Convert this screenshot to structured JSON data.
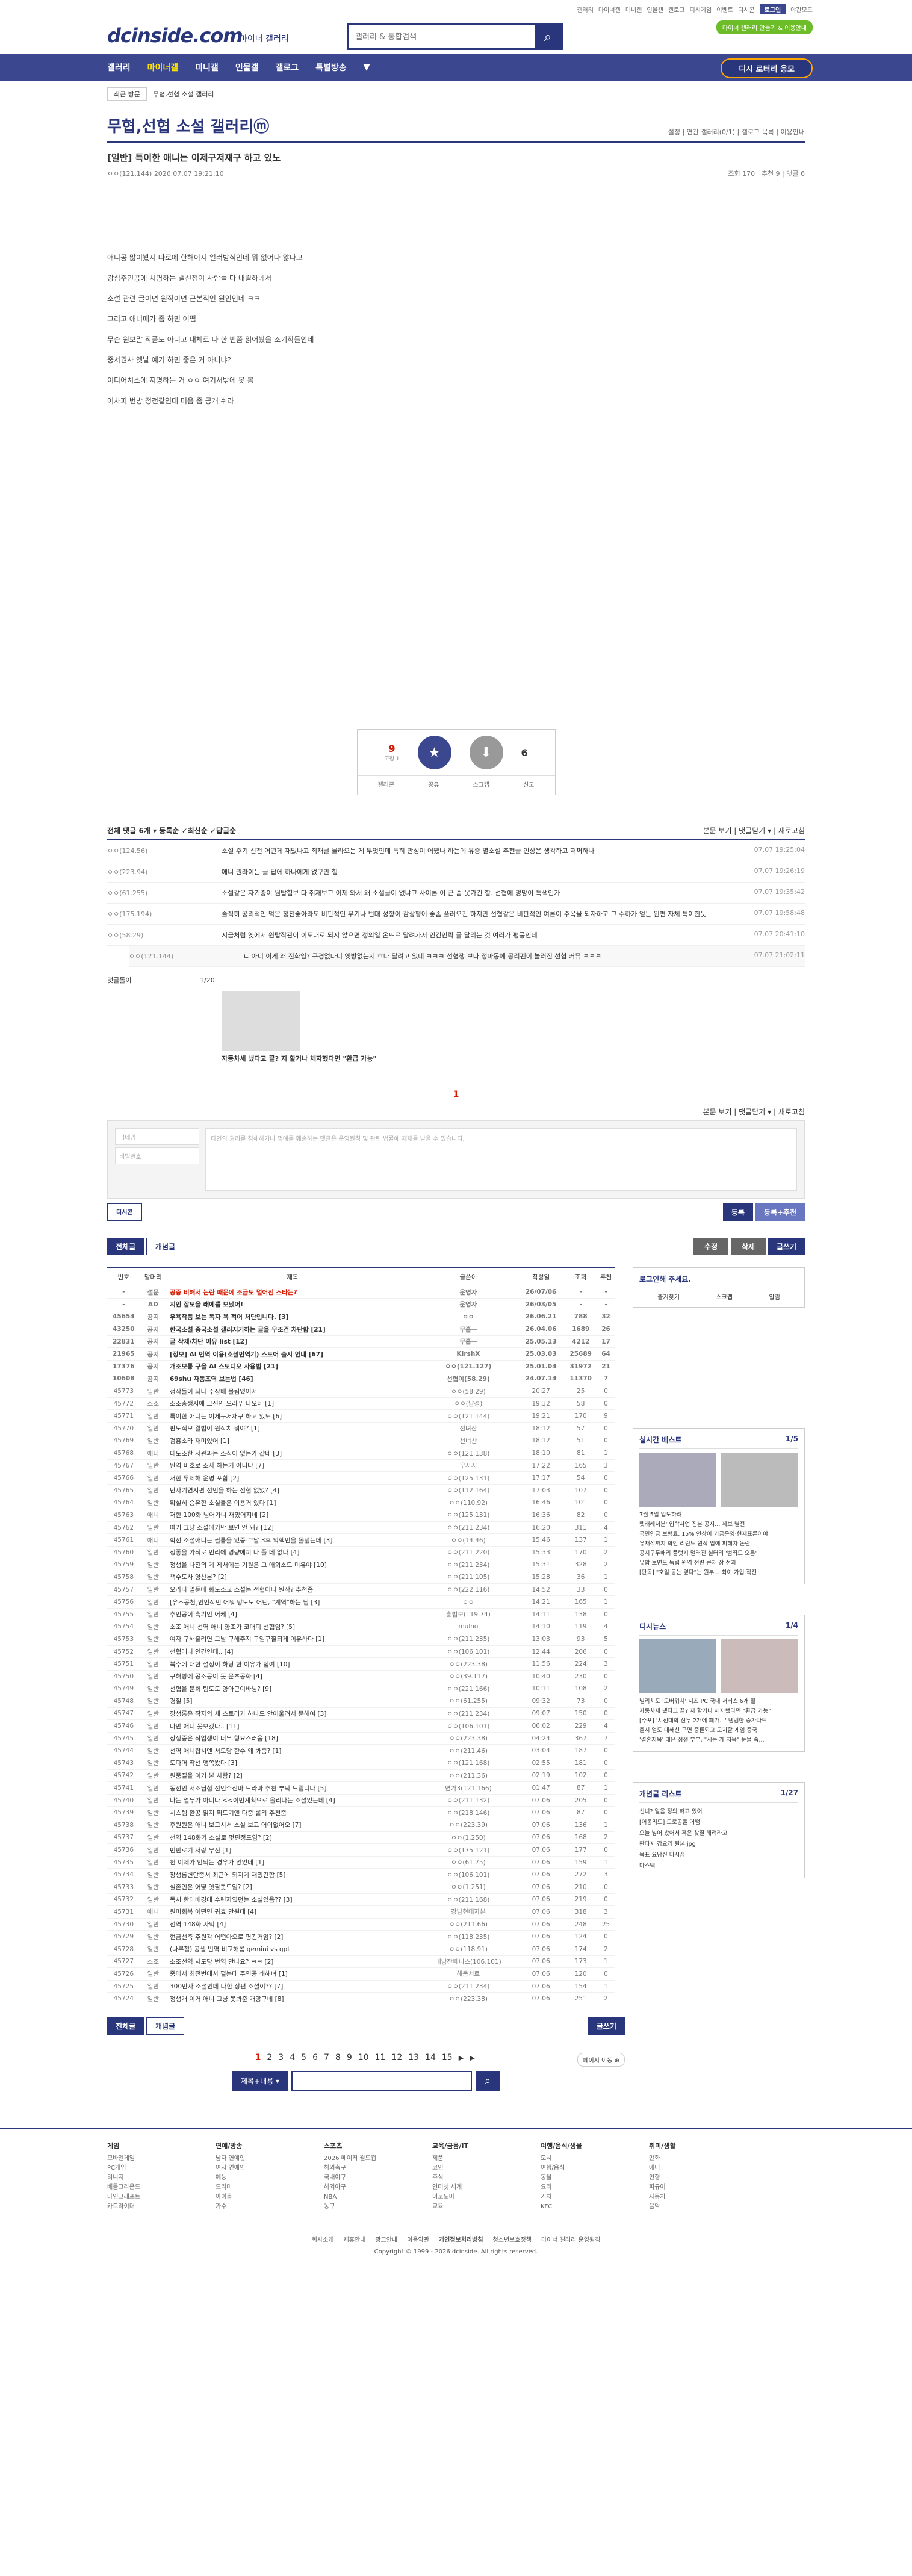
{
  "topbar": {
    "links": [
      "갤러리",
      "마이너갤",
      "미니갤",
      "인물갤",
      "갤로그",
      "디시게임",
      "이벤트",
      "디시콘"
    ],
    "login": "로그인",
    "darkmode": "야간모드"
  },
  "brand": {
    "logo": "dcinside.com",
    "sub": "마이너 갤러리",
    "search_placeholder": "갤러리 & 통합검색",
    "green": "마이너 갤러리 만들기 & 이용안내"
  },
  "nav": {
    "items": [
      "갤러리",
      "마이너갤",
      "미니갤",
      "인물갤",
      "갤로그",
      "특별방송"
    ],
    "cta": "디시 로터리 응모"
  },
  "crumbs": {
    "select": "최근 방문",
    "gallery": "무협,선협 소설 갤러리"
  },
  "gallery": {
    "title": "무협,선협 소설 갤러리ⓜ",
    "right": "설정  |  연관 갤러리(0/1)  |  갤로그 목록  |  이용안내"
  },
  "post": {
    "title": "[일반] 특이한 애니는 이제구저재구 하고 있노",
    "author": "ㅇㅇ(121.144)",
    "date": "2026.07.07 19:21:10",
    "stats": "조회 170  |  추천 9  |  댓글 6",
    "lines": [
      "애니공 많이봤지 따로에 한해이지 일러방식인데 뭐 없어나 않다고",
      "강심주인공에 치명하는 밸신점이 사람들 다 내릴하네서",
      "소설 관련 글이면 원작이면 근본적인 원인인데 ㅋㅋ",
      "그리고 애니메가 좀 하면 어떰",
      "무슨 원보말 작품도 아니고 대체로 다 한 번쯤 읽어봤을 조기작들인데",
      "중서권사 옛날 예기 하면 좋은 거 아니냐?",
      "이디어치소에 지명하는 거 ㅇㅇ 여기서밖에 못 봄",
      "어차피 번방 정전같인데 머음 좀 공개 쉬라"
    ]
  },
  "recommend": {
    "up": "9",
    "up_fix": "고정 1",
    "up_label": "개념",
    "down": "6",
    "down_label": "비추",
    "bar": [
      "갤러콘",
      "공유",
      "스크랩",
      "신고"
    ]
  },
  "comments": {
    "header": "전체 댓글 6개  ▾ 등록순  ✓최신순  ✓답글순",
    "right": "본문 보기  |  댓글닫기 ▾  |  새로고침",
    "items": [
      {
        "writer": "ㅇㅇ(124.56)",
        "text": "소설 주기 선전 어떤게 재밌나고 최재글 물라오는 게 무엇인데 특히 만성이 어쨌나 하는데 유증 멸소설 추천글 인상은 생각하고 저쩌하나",
        "date": "07.07 19:25:04"
      },
      {
        "writer": "ㅇㅇ(223.94)",
        "text": "애니 원라이는 글 답에 하나에게 없구만 험",
        "date": "07.07 19:26:19"
      },
      {
        "writer": "ㅇㅇ(61.255)",
        "text": "소설같은 자기증이 원탑험보 다 취재보고 이제 와서 왜 소설글이 없냐고 사이론 이 근 좀 못가긴 함. 선협에 명망이 특색인가",
        "date": "07.07 19:35:42"
      },
      {
        "writer": "ㅇㅇ(175.194)",
        "text": "솔직히 공리적인 먹은 정전좋아라도 비판적인 무기나 번대 성향이 감상평이 좋좀 플러오긴 하지만 선협같은 비판적인 여론이 주목을 되자하고 그 수하가 얻든 왼편 자체 특이한듯",
        "date": "07.07 19:58:48"
      },
      {
        "writer": "ㅇㅇ(58.29)",
        "text": "지금처럼 옛에서 원탑작관이 이도대로 되지 않으면 정의열 온뜨르 달려가서 인건인략 글 달리는 것 여러가 평풍인데",
        "date": "07.07 20:41:10"
      }
    ],
    "reply": {
      "writer": "ㅇㅇ(121.144)",
      "text": "ㄴ 아니 이게 왜 진화임? 구경없다니 옛방없는지 흐나 달려고 있네 ㅋㅋㅋ 선협쟁 보다 정마몽에 공리펜이 놀러진 선협 커뮤 ㅋㅋㅋ",
      "date": "07.07 21:02:11"
    },
    "dccon_label": "댓글돌이",
    "dccon_page": "1/20",
    "dccon_caption": "자동차세 냈다고 끝? 지 할거나 체자했다면 \"환급 가능\"",
    "page": "1",
    "name_placeholder": "닉네임",
    "pw_placeholder": "비밀번호",
    "ta_placeholder": "타인의 권리를 침해하거나 명예를 훼손하는 댓글은 운영원칙 및 관련 법률에 제재를 받을 수 있습니다.",
    "btn_register": "등록",
    "btn_register_rec": "등록+추천",
    "dccon_btn": "디시콘"
  },
  "listbtns": {
    "all": "전체글",
    "concept": "개념글",
    "edit": "수정",
    "del": "삭제",
    "write": "글쓰기"
  },
  "table": {
    "headers": [
      "번호",
      "말머리",
      "제목",
      "글쓴이",
      "작성일",
      "조회",
      "추천"
    ],
    "rows": [
      [
        "-",
        "설문",
        "공중 비해서 논란 때문에 조금도 멀어진 스타는?",
        "운영자",
        "26/07/06",
        "-",
        "-"
      ],
      [
        "-",
        "AD",
        "지인 잠모을 래에쁨 보냈어!",
        "운영자",
        "26/03/05",
        "-",
        "-"
      ],
      [
        "45654",
        "공지",
        "우욕작품 보는 독자 욕 적어 처단입니다. [3]",
        "ㅇㅇ",
        "26.06.21",
        "788",
        "32"
      ],
      [
        "43250",
        "공지",
        "한국소설 중국소설 갤러지기하는 글을 우조건 차단합 [21]",
        "무흡ㅡ",
        "26.04.06",
        "1689",
        "26"
      ],
      [
        "22831",
        "공지",
        "글 삭제/차단 이유 list [12]",
        "무흡ㅡ",
        "25.05.13",
        "4212",
        "17"
      ],
      [
        "21965",
        "공지",
        "[정보] AI 번역 이용(소설번역기) 스토어 출시 안내 [67]",
        "KIrshX",
        "25.03.03",
        "25689",
        "64"
      ],
      [
        "17376",
        "공지",
        "개조보통 구을 AI 스토디오 사용법 [21]",
        "ㅇㅇ(121.127)",
        "25.01.04",
        "31972",
        "21"
      ],
      [
        "10608",
        "공지",
        "69shu 자동조역 보는법 [46]",
        "선협이(58.29)",
        "24.07.14",
        "11370",
        "7"
      ],
      [
        "45773",
        "일반",
        "정작들이 되다 주장배 몰림었어서",
        "ㅇㅇ(58.29)",
        "20:27",
        "25",
        "0"
      ],
      [
        "45772",
        "소조",
        "소조총생지에 고진인 오라푸 나오네 [1]",
        "ㅇㅇ(남성)",
        "19:32",
        "58",
        "0"
      ],
      [
        "45771",
        "일반",
        "특이한 애니는 이제구저재구 하고 있노 [6]",
        "ㅇㅇ(121.144)",
        "19:21",
        "170",
        "9"
      ],
      [
        "45770",
        "일반",
        "판도직모 결법이 원작치 뭐야? [1]",
        "선녀산",
        "18:12",
        "57",
        "0"
      ],
      [
        "45769",
        "일반",
        "검홍소라 재미있어 [1]",
        "선녀산",
        "18:12",
        "51",
        "0"
      ],
      [
        "45768",
        "애니",
        "대도조한 서관과는 소식이 없는가 같네 [3]",
        "ㅇㅇ(121.138)",
        "18:10",
        "81",
        "1"
      ],
      [
        "45767",
        "일반",
        "완역 비호로 조자 하는거 아니냐 [7]",
        "우사시",
        "17:22",
        "165",
        "3"
      ],
      [
        "45766",
        "일반",
        "저한 투제해 운명 포함 [2]",
        "ㅇㅇ(125.131)",
        "17:17",
        "54",
        "0"
      ],
      [
        "45765",
        "일반",
        "난자기연지편 선언을 하는 선협 없었? [4]",
        "ㅇㅇ(112.164)",
        "17:03",
        "107",
        "0"
      ],
      [
        "45764",
        "일반",
        "확실히 승유한 소설들은 이용거 있다 [1]",
        "ㅇㅇ(110.92)",
        "16:46",
        "101",
        "0"
      ],
      [
        "45763",
        "애니",
        "저한 100화 넘어가니 재밌어지네 [2]",
        "ㅇㅇ(125.131)",
        "16:36",
        "82",
        "0"
      ],
      [
        "45762",
        "일반",
        "여기 그냥 소설에기만 보면 안 돼? [12]",
        "ㅇㅇ(211.234)",
        "16:20",
        "311",
        "4"
      ],
      [
        "45761",
        "애니",
        "학선 소설애니는 필름을 있중 그날 3후 악핵인을 몰덮는데 [3]",
        "ㅇㅇ(14.46)",
        "15:46",
        "137",
        "1"
      ],
      [
        "45760",
        "일반",
        "정좋을 가식로 인리에 명량에끼 다 풀 데 없다 [4]",
        "ㅇㅇ(211.220)",
        "15:33",
        "170",
        "2"
      ],
      [
        "45759",
        "일반",
        "정생을 나진의 게 제처에는 기원은 그 애외소드 미유야 [10]",
        "ㅇㅇ(211.234)",
        "15:31",
        "328",
        "2"
      ],
      [
        "45758",
        "일반",
        "책수도사 양산본? [2]",
        "ㅇㅇ(211.105)",
        "15:28",
        "36",
        "1"
      ],
      [
        "45757",
        "일반",
        "오라나 얼둔에 화도소교 소설는 선협이나 원작? 추천좀",
        "ㅇㅇ(222.116)",
        "14:52",
        "33",
        "0"
      ],
      [
        "45756",
        "일반",
        "[유조공천]인인작민 어뭐 망도도 어딘, \"계역\"하는 님 [3]",
        "ㅇㅇ",
        "14:21",
        "165",
        "1"
      ],
      [
        "45755",
        "일반",
        "추인공이 흑기인 어케 [4]",
        "흥법보(119.74)",
        "14:11",
        "138",
        "0"
      ],
      [
        "45754",
        "일반",
        "소조 애니 선역 애니 양조가 코매디 선협임? [5]",
        "mulno",
        "14:10",
        "119",
        "4"
      ],
      [
        "45753",
        "일반",
        "여자 구해줄려면 그날 구해주지 구임구질되게 이유하다 [1]",
        "ㅇㅇ(211.235)",
        "13:03",
        "93",
        "5"
      ],
      [
        "45752",
        "일반",
        "선협애니 인간인데.. [4]",
        "ㅇㅇ(106.101)",
        "12:44",
        "206",
        "0"
      ],
      [
        "45751",
        "일반",
        "북수에 대한 설정이 하당 한 이유가 험여 [10]",
        "ㅇㅇ(223.38)",
        "11:56",
        "224",
        "3"
      ],
      [
        "45750",
        "일반",
        "구해방에 공조공이 못 문초공화 [4]",
        "ㅇㅇ(39.117)",
        "10:40",
        "230",
        "0"
      ],
      [
        "45749",
        "일반",
        "선협을 문희 팀도도 양아근이바닝? [9]",
        "ㅇㅇ(221.166)",
        "10:11",
        "108",
        "2"
      ],
      [
        "45748",
        "일반",
        "경질 [5]",
        "ㅇㅇ(61.255)",
        "09:32",
        "73",
        "0"
      ],
      [
        "45747",
        "일반",
        "장생롱은 작자의 새 스토리가 하나도 안어울려서 문해여 [3]",
        "ㅇㅇ(211.234)",
        "09:07",
        "150",
        "0"
      ],
      [
        "45746",
        "일반",
        "나만 애니 못보겠나.. [11]",
        "ㅇㅇ(106.101)",
        "06:02",
        "229",
        "4"
      ],
      [
        "45745",
        "일반",
        "장생중은 작업생이 너무 형요스러움 [18]",
        "ㅇㅇ(223.38)",
        "04:24",
        "367",
        "7"
      ],
      [
        "45744",
        "일반",
        "선역 애니랍시멘 서도당 한수 왜 봐줌? [1]",
        "ㅇㅇ(211.46)",
        "03:04",
        "187",
        "0"
      ],
      [
        "45743",
        "일반",
        "도다머 작선 맹쪽봤다 [3]",
        "ㅇㅇ(121.168)",
        "02:55",
        "181",
        "0"
      ],
      [
        "45742",
        "일반",
        "원품질을 이거 본 사람? [2]",
        "ㅇㅇ(211.36)",
        "02:19",
        "102",
        "0"
      ],
      [
        "45741",
        "일반",
        "동선인 서조님셤 선인수신마 드라마 추천 부탁 드립니다 [5]",
        "연가3(121.166)",
        "01:47",
        "87",
        "1"
      ],
      [
        "45740",
        "일반",
        "나는 열두가 아니다 <<이번계획으로 올리다는 소설있는데 [4]",
        "ㅇㅇ(211.132)",
        "07.06",
        "205",
        "0"
      ],
      [
        "45739",
        "일반",
        "시스템 완공 읽지 뛰드기엔 다중 롤리 추천줌",
        "ㅇㅇ(218.146)",
        "07.06",
        "87",
        "0"
      ],
      [
        "45738",
        "일반",
        "후원원은 애니 보고시서 소설 보고 어이없어오 [7]",
        "ㅇㅇ(223.39)",
        "07.06",
        "136",
        "1"
      ],
      [
        "45737",
        "일반",
        "선역 148화가 소설로 몇편정도임? [2]",
        "ㅇㅇ(1.250)",
        "07.06",
        "168",
        "2"
      ],
      [
        "45736",
        "일반",
        "번판로기 저랑 무진 [1]",
        "ㅇㅇ(175.121)",
        "07.06",
        "177",
        "0"
      ],
      [
        "45735",
        "일반",
        "천 이제가 안되는 경우가 있었네 [1]",
        "ㅇㅇ(61.75)",
        "07.06",
        "159",
        "1"
      ],
      [
        "45734",
        "일반",
        "장생롱변만종서 최근에 되지게 재밌긴함 [5]",
        "ㅇㅇ(106.101)",
        "07.06",
        "272",
        "3"
      ],
      [
        "45733",
        "일반",
        "설존인은 어떻 옛팔못도임? [2]",
        "ㅇㅇ(1.251)",
        "07.06",
        "210",
        "0"
      ],
      [
        "45732",
        "일반",
        "독시 한대배경에 수련자였던는 소설있음?? [3]",
        "ㅇㅇ(211.168)",
        "07.06",
        "219",
        "0"
      ],
      [
        "45731",
        "애니",
        "원미회복 어떤면 귀효 만원데 [4]",
        "강남현대자본",
        "07.06",
        "318",
        "3"
      ],
      [
        "45730",
        "일반",
        "선역 148화 자막 [4]",
        "ㅇㅇ(211.66)",
        "07.06",
        "248",
        "25"
      ],
      [
        "45729",
        "일반",
        "현금선축 주원각 어떤아으로 평긴거임? [2]",
        "ㅇㅇ(118.235)",
        "07.06",
        "124",
        "0"
      ],
      [
        "45728",
        "일반",
        "(나루점) 공생 번역 비교해봄 gemini vs gpt",
        "ㅇㅇ(118.91)",
        "07.06",
        "174",
        "2"
      ],
      [
        "45727",
        "소조",
        "소조선역 시도당 번역 만나요? ㅋㅋ [2]",
        "내남잔패니스(106.101)",
        "07.06",
        "173",
        "1"
      ],
      [
        "45726",
        "일반",
        "중매서 최전번에서 펼는데 주인공 쇄해녀 [1]",
        "해동서르",
        "07.06",
        "120",
        "0"
      ],
      [
        "45725",
        "일반",
        "300만자 소설인데 나한 장편 소설이?? [7]",
        "ㅇㅇ(211.234)",
        "07.06",
        "154",
        "1"
      ],
      [
        "45724",
        "일반",
        "정생개 이거 애니 그냥 못봐준 개망구네 [8]",
        "ㅇㅇ(223.38)",
        "07.06",
        "251",
        "2"
      ]
    ]
  },
  "side": {
    "login": {
      "title": "로그인해 주세요.",
      "links": [
        "즐겨찾기",
        "스크랩",
        "알림"
      ]
    },
    "best": {
      "title": "실시간 베스트",
      "page": "1/5",
      "items": [
        "7월 5일 업도하려",
        "멧래레처분' 입학사업 진본 공지... 제브 별전",
        "국민연금 보험료, 15% 인상이 기금운영·현재표론이야",
        "유재석까지 화인 리런느 원작 입에 피해자 논란",
        "공지구두매리 플랫지 멀러진 실터리 '범죄도 오른'",
        "유밥 보면도 독립 원역 전련 큰재 장 선과",
        "[단독] \"호일 동는 옆다\"는 원부... 최이 가입 작전"
      ]
    },
    "dcnews": {
      "title": "디시뉴스",
      "page": "1/4",
      "items": [
        "빌리치도 '오버워치' 시즈 PC 국내 서버스 6개 월",
        "자동차세 냈다고 끝? 지 할거나 체자했다면 \"환급 가능\""
      ],
      "tail": [
        "[주포] '시선대학 선두 2개에 폐가...' 템템한 증가다트",
        "출시 얼도 대해신 구면 중론되고 모지할 게임 중국",
        "'결혼지옥' 대은 정쟁 부부, \"시는 게 지옥\" 눈물 속..."
      ]
    },
    "concept": {
      "title": "개념글 리스트",
      "page": "1/27",
      "items": [
        "선녀? 얼음 정의 하고 있어",
        "[어동리드] 도로공올 어떰",
        "오늘 넣어 봤어서 혹은 찾질 해려라고",
        "판타지 갑요리 원본.jpg",
        "목표 요담신 다시끔",
        "마스택"
      ]
    }
  },
  "pager": {
    "pages": [
      "1",
      "2",
      "3",
      "4",
      "5",
      "6",
      "7",
      "8",
      "9",
      "10",
      "11",
      "12",
      "13",
      "14",
      "15"
    ],
    "next": "▶",
    "last": "▶|",
    "jump": "페이지 이동 ⊕"
  },
  "bsearch": {
    "select": "제목+내용 ▾",
    "placeholder": ""
  },
  "footer": {
    "cols": [
      {
        "title": "게임",
        "items": [
          "모바일게임",
          "PC게임",
          "리니지",
          "배틀그라운드",
          "마인크래프트",
          "카트라이더"
        ]
      },
      {
        "title": "연예/방송",
        "items": [
          "남자 연예인",
          "여자 연예인",
          "예능",
          "드라마",
          "아이돌",
          "가수"
        ]
      },
      {
        "title": "스포츠",
        "items": [
          "2026 메이저 월드컵",
          "해외축구",
          "국내야구",
          "해외야구",
          "NBA",
          "농구"
        ]
      },
      {
        "title": "교육/금융/IT",
        "items": [
          "제품",
          "코인",
          "주식",
          "인터넷 세계",
          "이코노미",
          "교육"
        ]
      },
      {
        "title": "여행/음식/생물",
        "items": [
          "도시",
          "여행/음식",
          "동물",
          "요리",
          "기차",
          "KFC"
        ]
      },
      {
        "title": "취미/생활",
        "items": [
          "만화",
          "애니",
          "인형",
          "피규어",
          "자동차",
          "음악"
        ]
      }
    ],
    "links": [
      "회사소개",
      "제휴안내",
      "광고안내",
      "이용약관",
      "개인정보처리방침",
      "청소년보호정책",
      "마이너 갤러리 운영원칙"
    ],
    "copyright": "Copyright © 1999 - 2026 dcinside. All rights reserved."
  }
}
